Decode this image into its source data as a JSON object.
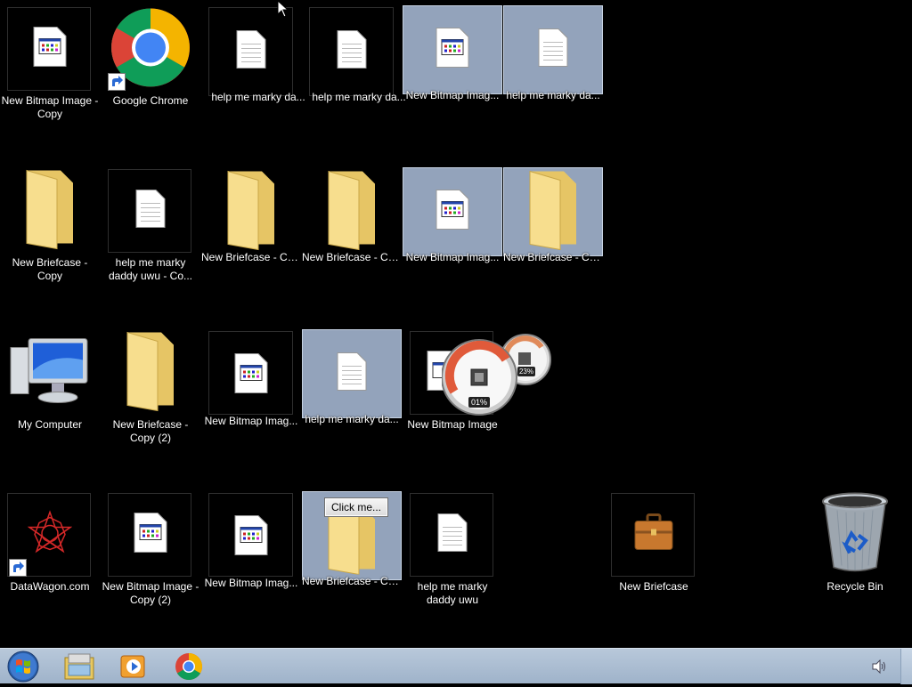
{
  "desktop": {
    "icons": [
      {
        "id": "bitmap-copy",
        "label": "New Bitmap Image -\nCopy"
      },
      {
        "id": "google-chrome",
        "label": "Google Chrome"
      },
      {
        "id": "text-1",
        "label": "help me marky da..."
      },
      {
        "id": "text-2",
        "label": "help me marky da..."
      },
      {
        "id": "bitmap-sel-1",
        "label": "New Bitmap Imag..."
      },
      {
        "id": "text-sel-1",
        "label": "help me marky da..."
      },
      {
        "id": "briefcase-copy",
        "label": "New Briefcase -\nCopy"
      },
      {
        "id": "text-uwu-copy",
        "label": "help me marky\ndaddy uwu - Co..."
      },
      {
        "id": "briefcase-co-1",
        "label": "New Briefcase - Co..."
      },
      {
        "id": "briefcase-co-2",
        "label": "New Briefcase - Co..."
      },
      {
        "id": "bitmap-sel-2",
        "label": "New Bitmap Imag..."
      },
      {
        "id": "briefcase-sel-1",
        "label": "New Briefcase - Co..."
      },
      {
        "id": "my-computer",
        "label": "My Computer"
      },
      {
        "id": "briefcase-copy-2",
        "label": "New Briefcase -\nCopy (2)"
      },
      {
        "id": "bitmap-3",
        "label": "New Bitmap Imag..."
      },
      {
        "id": "text-sel-2",
        "label": "help me marky da..."
      },
      {
        "id": "bitmap-4",
        "label": "New Bitmap Image"
      },
      {
        "id": "datawagon",
        "label": "DataWagon.com"
      },
      {
        "id": "bitmap-copy-2",
        "label": "New Bitmap Image -\nCopy (2)"
      },
      {
        "id": "bitmap-5",
        "label": "New Bitmap Imag..."
      },
      {
        "id": "briefcase-sel-2",
        "label": "New Briefcase - Co..."
      },
      {
        "id": "text-uwu",
        "label": "help me marky\ndaddy uwu"
      },
      {
        "id": "new-briefcase",
        "label": "New Briefcase"
      },
      {
        "id": "recycle-bin",
        "label": "Recycle Bin"
      }
    ],
    "gadget": {
      "cpu_percent": "01%",
      "memory_percent": "23%"
    },
    "dialog_button": "Click me..."
  },
  "taskbar": {
    "start_icon": "windows-orb-icon",
    "pinned": [
      "explorer-icon",
      "media-player-icon",
      "chrome-icon"
    ],
    "tray_icon": "speaker-icon"
  }
}
